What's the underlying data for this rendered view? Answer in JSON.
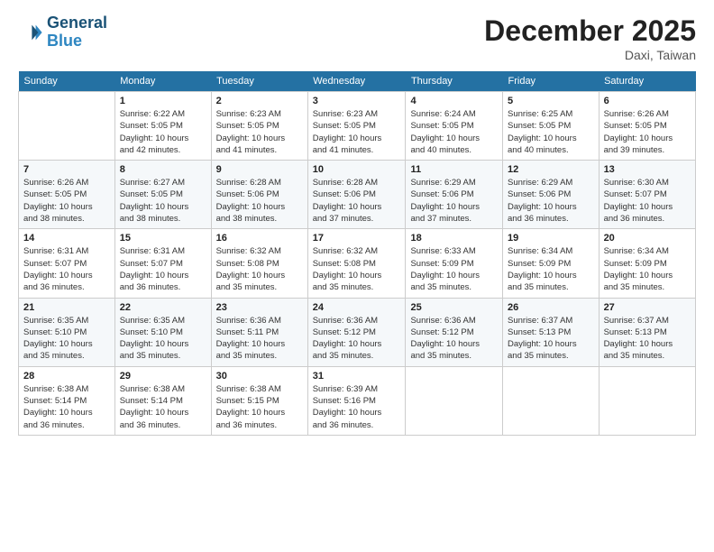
{
  "header": {
    "logo_line1": "General",
    "logo_line2": "Blue",
    "month_title": "December 2025",
    "location": "Daxi, Taiwan"
  },
  "weekdays": [
    "Sunday",
    "Monday",
    "Tuesday",
    "Wednesday",
    "Thursday",
    "Friday",
    "Saturday"
  ],
  "weeks": [
    [
      {
        "day": "",
        "info": ""
      },
      {
        "day": "1",
        "info": "Sunrise: 6:22 AM\nSunset: 5:05 PM\nDaylight: 10 hours\nand 42 minutes."
      },
      {
        "day": "2",
        "info": "Sunrise: 6:23 AM\nSunset: 5:05 PM\nDaylight: 10 hours\nand 41 minutes."
      },
      {
        "day": "3",
        "info": "Sunrise: 6:23 AM\nSunset: 5:05 PM\nDaylight: 10 hours\nand 41 minutes."
      },
      {
        "day": "4",
        "info": "Sunrise: 6:24 AM\nSunset: 5:05 PM\nDaylight: 10 hours\nand 40 minutes."
      },
      {
        "day": "5",
        "info": "Sunrise: 6:25 AM\nSunset: 5:05 PM\nDaylight: 10 hours\nand 40 minutes."
      },
      {
        "day": "6",
        "info": "Sunrise: 6:26 AM\nSunset: 5:05 PM\nDaylight: 10 hours\nand 39 minutes."
      }
    ],
    [
      {
        "day": "7",
        "info": "Sunrise: 6:26 AM\nSunset: 5:05 PM\nDaylight: 10 hours\nand 38 minutes."
      },
      {
        "day": "8",
        "info": "Sunrise: 6:27 AM\nSunset: 5:05 PM\nDaylight: 10 hours\nand 38 minutes."
      },
      {
        "day": "9",
        "info": "Sunrise: 6:28 AM\nSunset: 5:06 PM\nDaylight: 10 hours\nand 38 minutes."
      },
      {
        "day": "10",
        "info": "Sunrise: 6:28 AM\nSunset: 5:06 PM\nDaylight: 10 hours\nand 37 minutes."
      },
      {
        "day": "11",
        "info": "Sunrise: 6:29 AM\nSunset: 5:06 PM\nDaylight: 10 hours\nand 37 minutes."
      },
      {
        "day": "12",
        "info": "Sunrise: 6:29 AM\nSunset: 5:06 PM\nDaylight: 10 hours\nand 36 minutes."
      },
      {
        "day": "13",
        "info": "Sunrise: 6:30 AM\nSunset: 5:07 PM\nDaylight: 10 hours\nand 36 minutes."
      }
    ],
    [
      {
        "day": "14",
        "info": "Sunrise: 6:31 AM\nSunset: 5:07 PM\nDaylight: 10 hours\nand 36 minutes."
      },
      {
        "day": "15",
        "info": "Sunrise: 6:31 AM\nSunset: 5:07 PM\nDaylight: 10 hours\nand 36 minutes."
      },
      {
        "day": "16",
        "info": "Sunrise: 6:32 AM\nSunset: 5:08 PM\nDaylight: 10 hours\nand 35 minutes."
      },
      {
        "day": "17",
        "info": "Sunrise: 6:32 AM\nSunset: 5:08 PM\nDaylight: 10 hours\nand 35 minutes."
      },
      {
        "day": "18",
        "info": "Sunrise: 6:33 AM\nSunset: 5:09 PM\nDaylight: 10 hours\nand 35 minutes."
      },
      {
        "day": "19",
        "info": "Sunrise: 6:34 AM\nSunset: 5:09 PM\nDaylight: 10 hours\nand 35 minutes."
      },
      {
        "day": "20",
        "info": "Sunrise: 6:34 AM\nSunset: 5:09 PM\nDaylight: 10 hours\nand 35 minutes."
      }
    ],
    [
      {
        "day": "21",
        "info": "Sunrise: 6:35 AM\nSunset: 5:10 PM\nDaylight: 10 hours\nand 35 minutes."
      },
      {
        "day": "22",
        "info": "Sunrise: 6:35 AM\nSunset: 5:10 PM\nDaylight: 10 hours\nand 35 minutes."
      },
      {
        "day": "23",
        "info": "Sunrise: 6:36 AM\nSunset: 5:11 PM\nDaylight: 10 hours\nand 35 minutes."
      },
      {
        "day": "24",
        "info": "Sunrise: 6:36 AM\nSunset: 5:12 PM\nDaylight: 10 hours\nand 35 minutes."
      },
      {
        "day": "25",
        "info": "Sunrise: 6:36 AM\nSunset: 5:12 PM\nDaylight: 10 hours\nand 35 minutes."
      },
      {
        "day": "26",
        "info": "Sunrise: 6:37 AM\nSunset: 5:13 PM\nDaylight: 10 hours\nand 35 minutes."
      },
      {
        "day": "27",
        "info": "Sunrise: 6:37 AM\nSunset: 5:13 PM\nDaylight: 10 hours\nand 35 minutes."
      }
    ],
    [
      {
        "day": "28",
        "info": "Sunrise: 6:38 AM\nSunset: 5:14 PM\nDaylight: 10 hours\nand 36 minutes."
      },
      {
        "day": "29",
        "info": "Sunrise: 6:38 AM\nSunset: 5:14 PM\nDaylight: 10 hours\nand 36 minutes."
      },
      {
        "day": "30",
        "info": "Sunrise: 6:38 AM\nSunset: 5:15 PM\nDaylight: 10 hours\nand 36 minutes."
      },
      {
        "day": "31",
        "info": "Sunrise: 6:39 AM\nSunset: 5:16 PM\nDaylight: 10 hours\nand 36 minutes."
      },
      {
        "day": "",
        "info": ""
      },
      {
        "day": "",
        "info": ""
      },
      {
        "day": "",
        "info": ""
      }
    ]
  ]
}
